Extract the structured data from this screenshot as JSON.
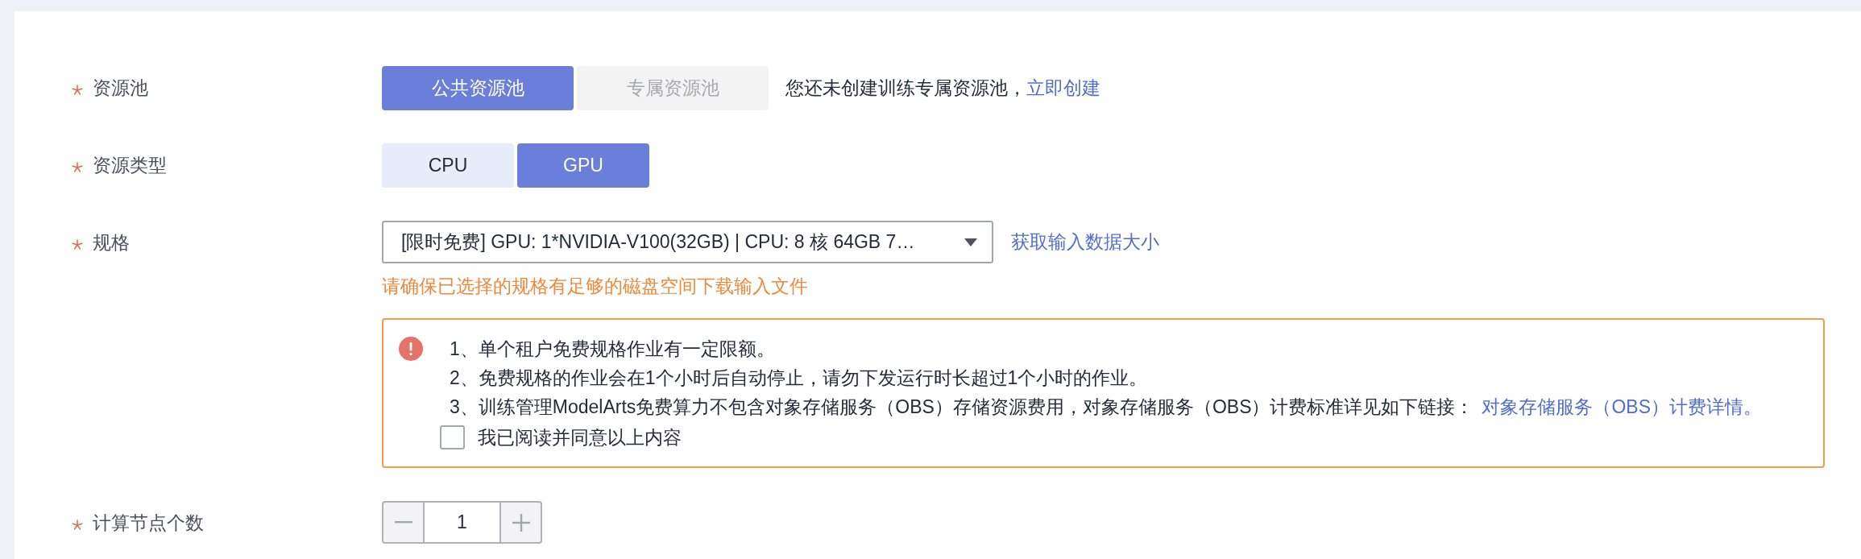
{
  "form": {
    "fields": [
      {
        "kind": "toggle",
        "label": "资源池",
        "required": true,
        "options": [
          {
            "label": "公共资源池",
            "selected": true,
            "disabled": false
          },
          {
            "label": "专属资源池",
            "selected": false,
            "disabled": true
          }
        ],
        "note": "您还未创建训练专属资源池，",
        "note_link": "立即创建"
      },
      {
        "kind": "toggle",
        "label": "资源类型",
        "required": true,
        "options": [
          {
            "label": "CPU",
            "selected": false,
            "disabled": false
          },
          {
            "label": "GPU",
            "selected": true,
            "disabled": false
          }
        ]
      },
      {
        "kind": "select",
        "label": "规格",
        "required": true,
        "value": "[限时免费] GPU: 1*NVIDIA-V100(32GB) | CPU: 8 核 64GB 7…",
        "link": "获取输入数据大小",
        "hint": "请确保已选择的规格有足够的磁盘空间下载输入文件",
        "notice": {
          "lines": [
            {
              "text": "1、单个租户免费规格作业有一定限额。"
            },
            {
              "text": "2、免费规格的作业会在1个小时后自动停止，请勿下发运行时长超过1个小时的作业。"
            },
            {
              "text": "3、训练管理ModelArts免费算力不包含对象存储服务（OBS）存储资源费用，对象存储服务（OBS）计费标准详见如下链接：",
              "link": "对象存储服务（OBS）计费详情。"
            }
          ],
          "checkbox": {
            "label": "我已阅读并同意以上内容",
            "checked": false
          }
        }
      },
      {
        "kind": "stepper",
        "label": "计算节点个数",
        "required": true,
        "value": "1"
      }
    ]
  }
}
